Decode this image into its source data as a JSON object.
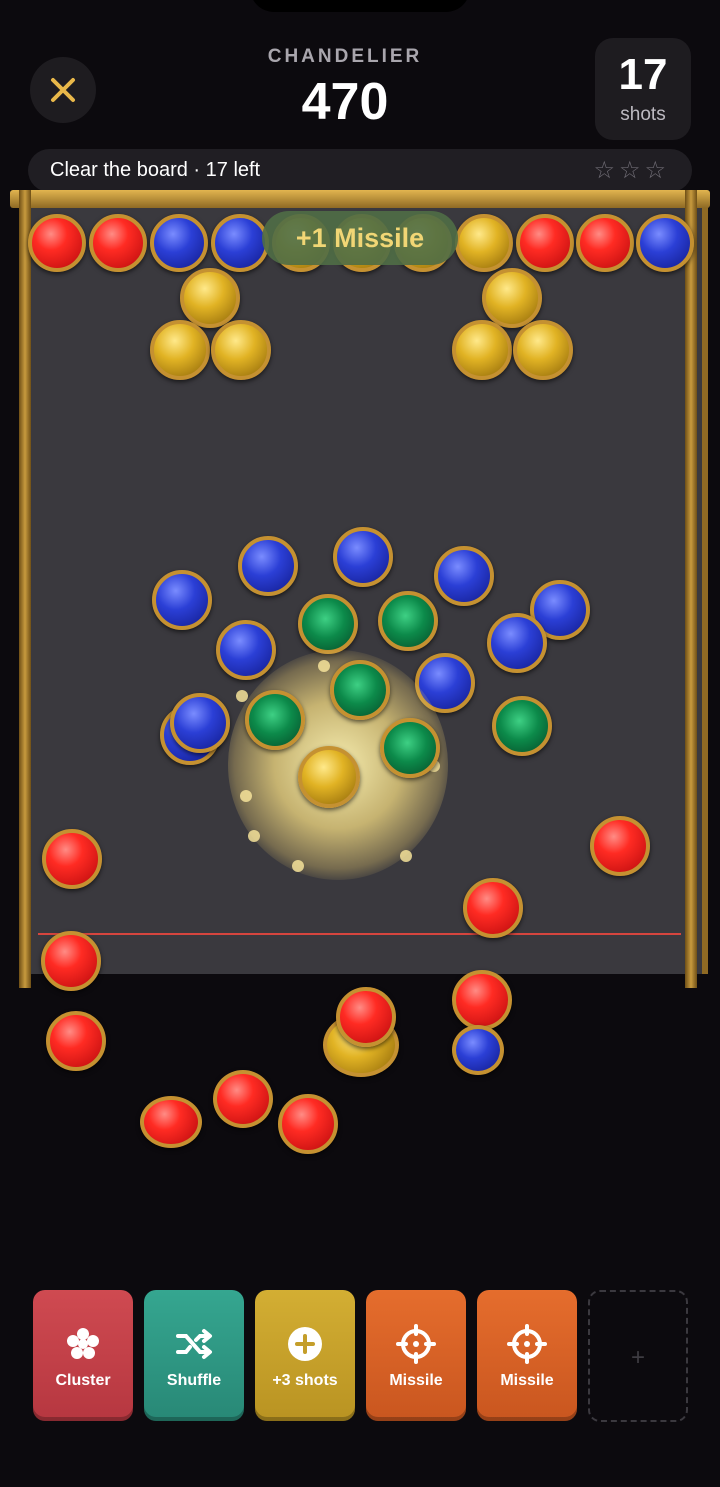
{
  "header": {
    "level_name": "CHANDELIER",
    "score": "470",
    "shots_count": "17",
    "shots_label": "shots"
  },
  "goal": {
    "text": "Clear the board · 17 left",
    "stars": "☆☆☆"
  },
  "toast": "+1 Missile",
  "powerups": [
    {
      "label": "Cluster",
      "color": "#c9414a"
    },
    {
      "label": "Shuffle",
      "color": "#2f9b86"
    },
    {
      "label": "+3 shots",
      "color": "#caa52c"
    },
    {
      "label": "Missile",
      "color": "#dd6428"
    },
    {
      "label": "Missile",
      "color": "#dd6428"
    }
  ],
  "empty_slot": "+",
  "colors": {
    "red": "#e3201b",
    "blue": "#2b3fd6",
    "green": "#0c8a4a",
    "gold": "#e1b324",
    "frame": "#c59131"
  }
}
